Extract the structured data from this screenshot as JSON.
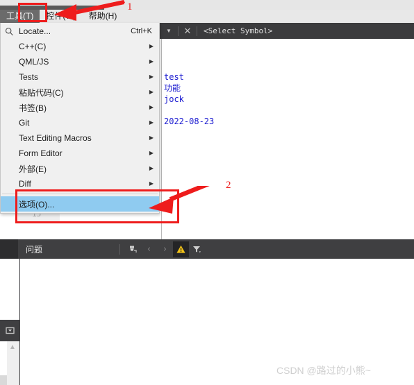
{
  "menubar": {
    "items": [
      {
        "label": "工具(T)",
        "active": true
      },
      {
        "label": "控件(W)",
        "active": false
      },
      {
        "label": "帮助(H)",
        "active": false
      }
    ]
  },
  "dropdown": {
    "items": [
      {
        "label": "Locate...",
        "shortcut": "Ctrl+K",
        "icon": "search-icon",
        "submenu": false
      },
      {
        "label": "C++(C)",
        "shortcut": "",
        "submenu": true
      },
      {
        "label": "QML/JS",
        "shortcut": "",
        "submenu": true
      },
      {
        "label": "Tests",
        "shortcut": "",
        "submenu": true
      },
      {
        "label": "粘贴代码(C)",
        "shortcut": "",
        "submenu": true
      },
      {
        "label": "书签(B)",
        "shortcut": "",
        "submenu": true
      },
      {
        "label": "Git",
        "shortcut": "",
        "submenu": true
      },
      {
        "label": "Text Editing Macros",
        "shortcut": "",
        "submenu": true
      },
      {
        "label": "Form Editor",
        "shortcut": "",
        "submenu": true
      },
      {
        "label": "外部(E)",
        "shortcut": "",
        "submenu": true
      },
      {
        "label": "Diff",
        "shortcut": "",
        "submenu": true
      }
    ],
    "options_item": {
      "label": "选项(O)...",
      "highlighted": true
    }
  },
  "editor": {
    "toolbar": {
      "dropdown_arrow": "▼",
      "close_label": "✕",
      "symbol_selector": "<Select Symbol>"
    },
    "code_lines": [
      "test",
      "功能",
      "jock",
      "",
      "2022-08-23"
    ],
    "line_number": "15"
  },
  "panel": {
    "title": "问题",
    "buttons": [
      {
        "name": "clear-icon",
        "glyph": ""
      },
      {
        "name": "prev-issue-icon",
        "glyph": "‹"
      },
      {
        "name": "next-issue-icon",
        "glyph": "›"
      },
      {
        "name": "warning-filter-icon",
        "glyph": "⚠"
      },
      {
        "name": "filter-icon",
        "glyph": ""
      }
    ]
  },
  "annotations": {
    "badge_1": "1",
    "badge_2": "2",
    "color": "#ee1c1c"
  },
  "watermark": "CSDN @路过的小熊~"
}
